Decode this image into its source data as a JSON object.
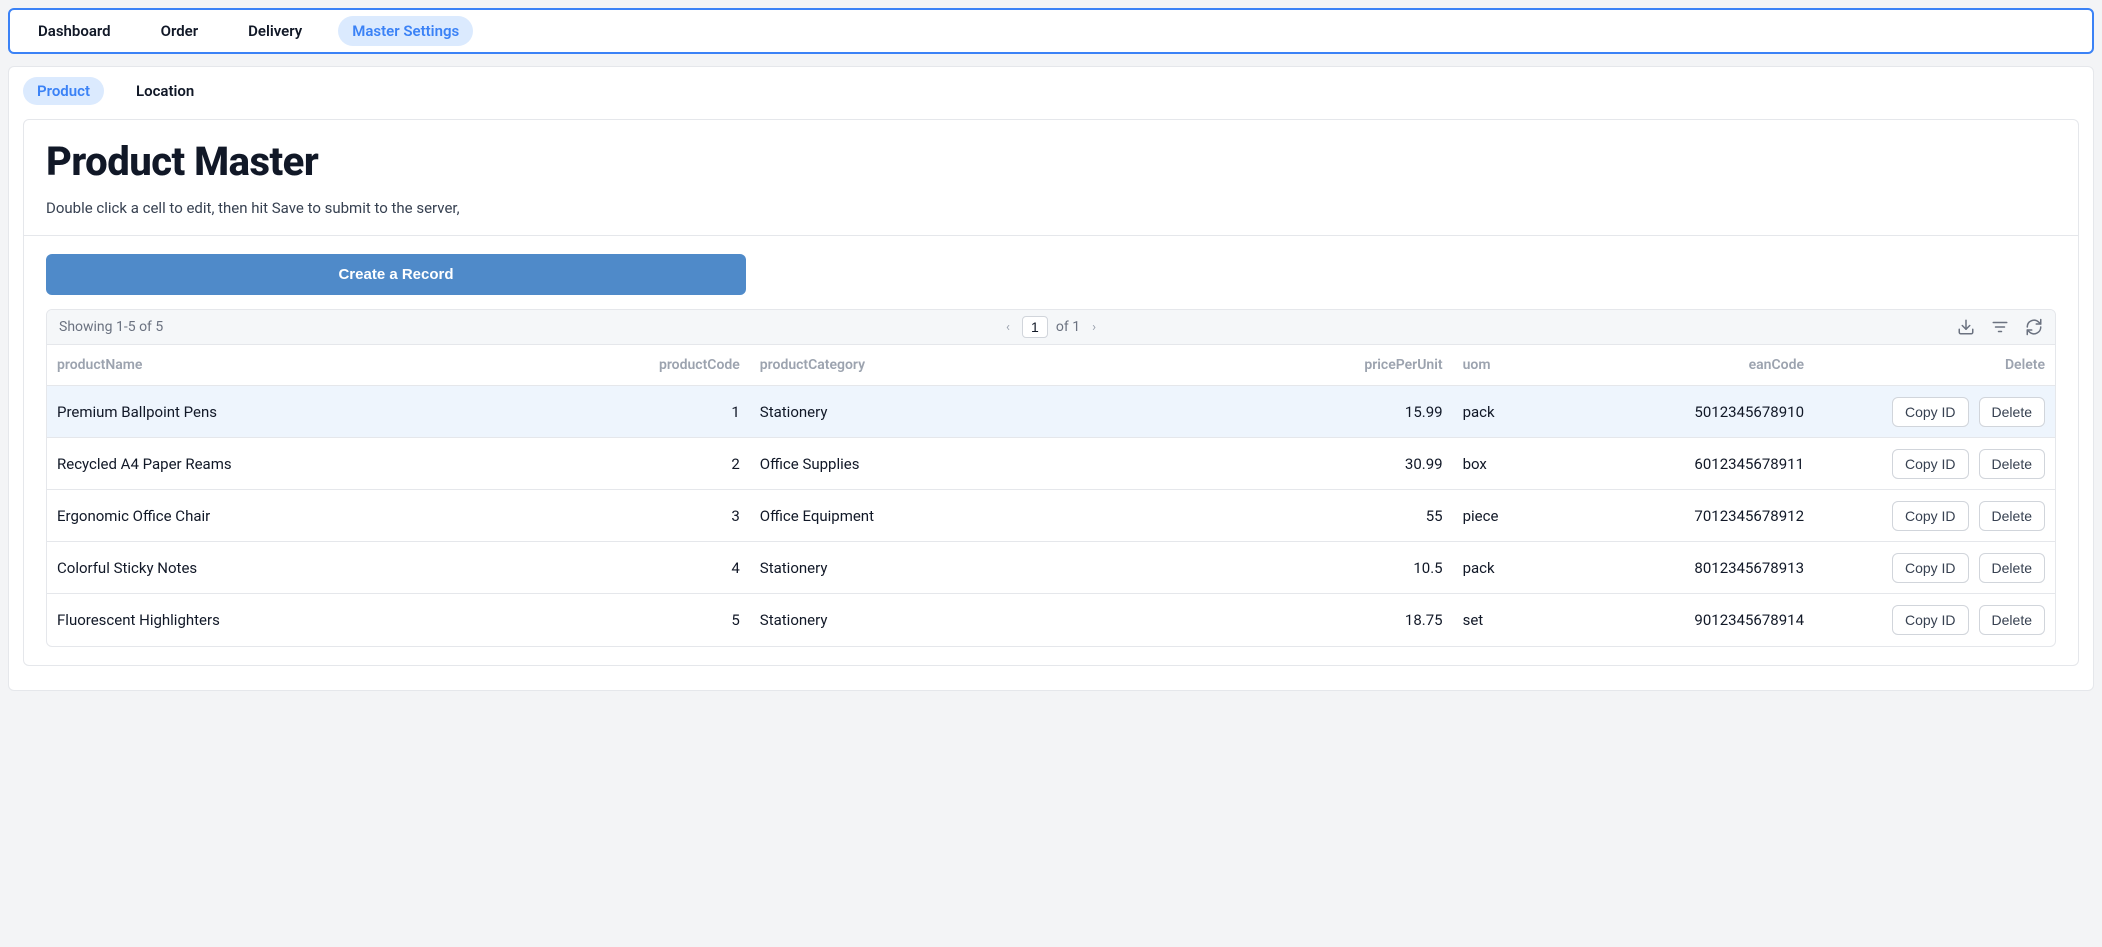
{
  "topNav": {
    "items": [
      {
        "label": "Dashboard",
        "active": false
      },
      {
        "label": "Order",
        "active": false
      },
      {
        "label": "Delivery",
        "active": false
      },
      {
        "label": "Master Settings",
        "active": true
      }
    ]
  },
  "subNav": {
    "items": [
      {
        "label": "Product",
        "active": true
      },
      {
        "label": "Location",
        "active": false
      }
    ]
  },
  "page": {
    "title": "Product Master",
    "subtitle": "Double click a cell to edit, then hit Save to submit to the server,",
    "createButton": "Create a Record"
  },
  "table": {
    "showingText": "Showing 1-5 of 5",
    "page": "1",
    "pageOf": "of 1",
    "headers": {
      "productName": "productName",
      "productCode": "productCode",
      "productCategory": "productCategory",
      "pricePerUnit": "pricePerUnit",
      "uom": "uom",
      "eanCode": "eanCode",
      "delete": "Delete"
    },
    "rows": [
      {
        "productName": "Premium Ballpoint Pens",
        "productCode": "1",
        "productCategory": "Stationery",
        "pricePerUnit": "15.99",
        "uom": "pack",
        "eanCode": "5012345678910",
        "highlight": true
      },
      {
        "productName": "Recycled A4 Paper Reams",
        "productCode": "2",
        "productCategory": "Office Supplies",
        "pricePerUnit": "30.99",
        "uom": "box",
        "eanCode": "6012345678911",
        "highlight": false
      },
      {
        "productName": "Ergonomic Office Chair",
        "productCode": "3",
        "productCategory": "Office Equipment",
        "pricePerUnit": "55",
        "uom": "piece",
        "eanCode": "7012345678912",
        "highlight": false
      },
      {
        "productName": "Colorful Sticky Notes",
        "productCode": "4",
        "productCategory": "Stationery",
        "pricePerUnit": "10.5",
        "uom": "pack",
        "eanCode": "8012345678913",
        "highlight": false
      },
      {
        "productName": "Fluorescent Highlighters",
        "productCode": "5",
        "productCategory": "Stationery",
        "pricePerUnit": "18.75",
        "uom": "set",
        "eanCode": "9012345678914",
        "highlight": false
      }
    ],
    "actions": {
      "copyId": "Copy ID",
      "delete": "Delete"
    }
  }
}
